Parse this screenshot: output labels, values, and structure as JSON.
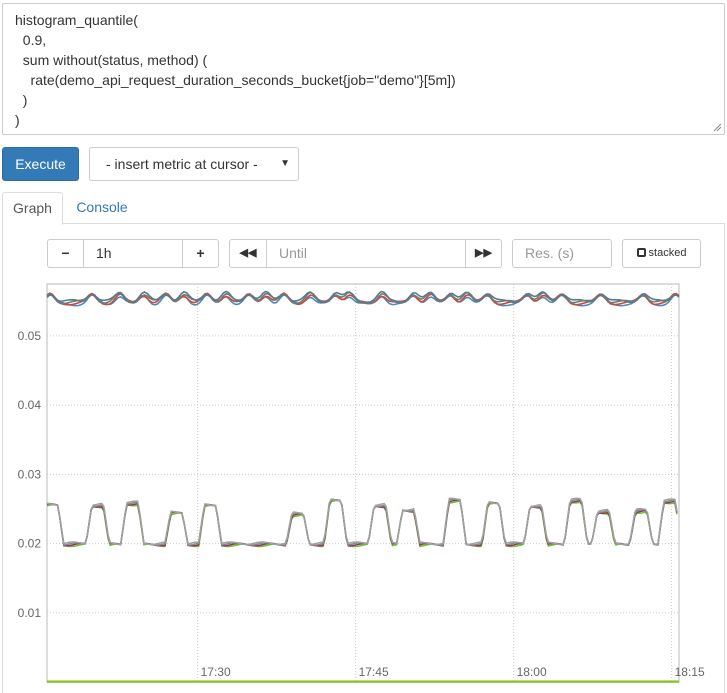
{
  "query": {
    "lines": [
      "histogram_quantile(",
      "  0.9,",
      "  sum without(status, method) (",
      "    rate(demo_api_request_duration_seconds_bucket{job=\"demo\"}[5m])",
      "  )",
      ")"
    ]
  },
  "toolbar": {
    "execute_label": "Execute",
    "metric_select_label": "- insert metric at cursor -"
  },
  "tabs": [
    {
      "label": "Graph",
      "active": true
    },
    {
      "label": "Console",
      "active": false
    }
  ],
  "graph_controls": {
    "range_minus": "−",
    "range_value": "1h",
    "range_plus": "+",
    "until_back": "◀◀",
    "until_placeholder": "Until",
    "until_forward": "▶▶",
    "resolution_placeholder": "Res. (s)",
    "stacked_label": "stacked"
  },
  "chart_data": {
    "type": "line",
    "y_ticks": [
      0.01,
      0.02,
      0.03,
      0.04,
      0.05
    ],
    "y_tick_labels": [
      "0.01",
      "0.02",
      "0.03",
      "0.04",
      "0.05"
    ],
    "x_tick_labels": [
      "17:30",
      "17:45",
      "18:00",
      "18:15"
    ],
    "ylim": [
      0,
      0.0575
    ],
    "xlim_minutes": [
      0,
      60
    ],
    "x_ticks_minutes": [
      14.3,
      29.3,
      44.3,
      59.3
    ],
    "grid": true,
    "upper_band": {
      "base": 0.0548,
      "bump_height": 0.0012,
      "bump_positions_minutes": [
        0.3,
        4.3,
        6.9,
        9.2,
        11.3,
        13.0,
        15.2,
        17.0,
        19.2,
        20.8,
        22.5,
        25.0,
        27.4,
        28.7,
        31.8,
        34.8,
        36.4,
        38.3,
        39.9,
        41.8,
        45.6,
        47.1,
        48.9,
        52.6,
        56.6,
        59.7
      ]
    },
    "lower_band": {
      "base": 0.0199,
      "spike_value": 0.0257,
      "spike_positions_minutes": [
        0.5,
        4.8,
        8.1,
        12.3,
        15.5,
        23.8,
        27.4,
        31.6,
        34.3,
        38.7,
        42.4,
        46.4,
        50.2,
        52.8,
        56.4,
        59.1
      ],
      "spike_heights": [
        0.0256,
        0.0255,
        0.0258,
        0.0244,
        0.0255,
        0.0242,
        0.0262,
        0.0255,
        0.0248,
        0.0262,
        0.0258,
        0.0254,
        0.0262,
        0.0246,
        0.0247,
        0.0261
      ]
    },
    "colors": {
      "upper_series": [
        "#4f8bb8",
        "#c44e3a",
        "#777777",
        "#5a7a8a"
      ],
      "lower_series": [
        "#6bc235",
        "#8c3a5a",
        "#888888",
        "#a0a0a0"
      ],
      "bottom_series": [
        "#c8c832",
        "#6bc235"
      ]
    }
  }
}
